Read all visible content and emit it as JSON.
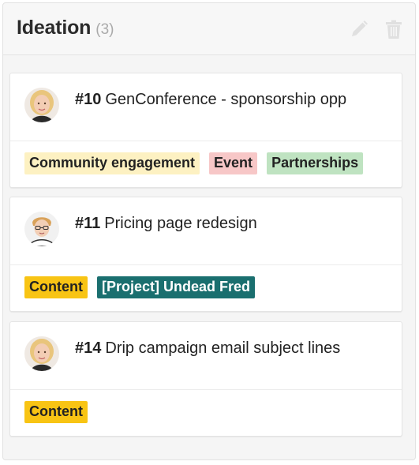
{
  "column": {
    "title": "Ideation",
    "count": "(3)",
    "actions": [
      {
        "icon": "pencil-icon"
      },
      {
        "icon": "trash-icon"
      }
    ]
  },
  "cards": [
    {
      "number": "#10",
      "title": "GenConference - sponsorship opp",
      "avatar": "avatar-blonde-woman",
      "tags": [
        {
          "label": "Community engagement",
          "color": "#fdf1c2"
        },
        {
          "label": "Event",
          "color": "#f7c7c7"
        },
        {
          "label": "Partnerships",
          "color": "#bfe3c1"
        }
      ]
    },
    {
      "number": "#11",
      "title": "Pricing page redesign",
      "avatar": "avatar-man-glasses",
      "tags": [
        {
          "label": "Content",
          "color": "#f8c414"
        },
        {
          "label": "[Project] Undead Fred",
          "color": "#1a6f6f",
          "text_color": "#ffffff"
        }
      ]
    },
    {
      "number": "#14",
      "title": "Drip campaign email subject lines",
      "avatar": "avatar-blonde-woman",
      "tags": [
        {
          "label": "Content",
          "color": "#f8c414"
        }
      ]
    }
  ]
}
